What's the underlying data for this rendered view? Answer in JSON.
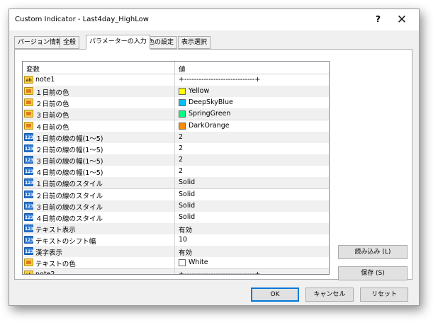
{
  "window": {
    "title": "Custom Indicator - Last4day_HighLow",
    "help_label": "?",
    "close_label": "✕"
  },
  "tabs": [
    {
      "label": "バージョン情報"
    },
    {
      "label": "全般"
    },
    {
      "label": "パラメーターの入力"
    },
    {
      "label": "色の設定"
    },
    {
      "label": "表示選択"
    }
  ],
  "grid": {
    "header": {
      "name": "変数",
      "value": "値"
    },
    "rows": [
      {
        "icon": "ab",
        "name": "note1",
        "value": "+-----------------------------+"
      },
      {
        "icon": "color",
        "name": "１日前の色",
        "value": "Yellow",
        "swatch": "#ffff00"
      },
      {
        "icon": "color",
        "name": "２日前の色",
        "value": "DeepSkyBlue",
        "swatch": "#00bfff"
      },
      {
        "icon": "color",
        "name": "３日前の色",
        "value": "SpringGreen",
        "swatch": "#00ff7f"
      },
      {
        "icon": "color",
        "name": "４日前の色",
        "value": "DarkOrange",
        "swatch": "#ff8c00"
      },
      {
        "icon": "123",
        "name": "１日前の線の幅(1〜5)",
        "value": "2"
      },
      {
        "icon": "123",
        "name": "２日前の線の幅(1〜5)",
        "value": "2"
      },
      {
        "icon": "123",
        "name": "３日前の線の幅(1〜5)",
        "value": "2"
      },
      {
        "icon": "123",
        "name": "４日前の線の幅(1〜5)",
        "value": "2"
      },
      {
        "icon": "123",
        "name": "１日前の線のスタイル",
        "value": "Solid"
      },
      {
        "icon": "123",
        "name": "２日前の線のスタイル",
        "value": "Solid"
      },
      {
        "icon": "123",
        "name": "３日前の線のスタイル",
        "value": "Solid"
      },
      {
        "icon": "123",
        "name": "４日前の線のスタイル",
        "value": "Solid"
      },
      {
        "icon": "123",
        "name": "テキスト表示",
        "value": "有効"
      },
      {
        "icon": "123",
        "name": "テキストのシフト幅",
        "value": "10"
      },
      {
        "icon": "123",
        "name": "漢字表示",
        "value": "有効"
      },
      {
        "icon": "color",
        "name": "テキストの色",
        "value": "White",
        "swatch": "#ffffff"
      },
      {
        "icon": "ab",
        "name": "note2",
        "value": "+-----------------------------+"
      }
    ]
  },
  "side_buttons": {
    "load_label": "読み込み (L)",
    "save_label": "保存 (S)"
  },
  "footer_buttons": {
    "ok_label": "OK",
    "cancel_label": "キャンセル",
    "reset_label": "リセット"
  }
}
